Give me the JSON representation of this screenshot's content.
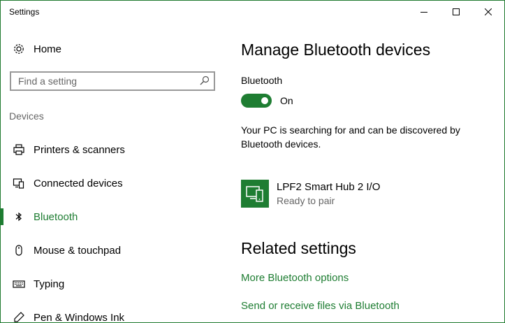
{
  "window": {
    "title": "Settings",
    "accent": "#1e7d32"
  },
  "titlebar": {
    "minimize_icon": "minimize-icon",
    "maximize_icon": "maximize-icon",
    "close_icon": "close-icon"
  },
  "sidebar": {
    "home_label": "Home",
    "search": {
      "placeholder": "Find a setting",
      "value": ""
    },
    "section": "Devices",
    "items": [
      {
        "label": "Printers & scanners",
        "icon": "printer-icon",
        "selected": false
      },
      {
        "label": "Connected devices",
        "icon": "connected-devices-icon",
        "selected": false
      },
      {
        "label": "Bluetooth",
        "icon": "bluetooth-icon",
        "selected": true
      },
      {
        "label": "Mouse & touchpad",
        "icon": "mouse-icon",
        "selected": false
      },
      {
        "label": "Typing",
        "icon": "keyboard-icon",
        "selected": false
      },
      {
        "label": "Pen & Windows Ink",
        "icon": "pen-icon",
        "selected": false
      }
    ]
  },
  "main": {
    "heading": "Manage Bluetooth devices",
    "bluetooth_label": "Bluetooth",
    "toggle_state": "On",
    "description": "Your PC is searching for and can be discovered by Bluetooth devices.",
    "device": {
      "name": "LPF2 Smart Hub 2 I/O",
      "status": "Ready to pair",
      "icon": "device-icon"
    },
    "related_heading": "Related settings",
    "links": [
      "More Bluetooth options",
      "Send or receive files via Bluetooth"
    ]
  }
}
